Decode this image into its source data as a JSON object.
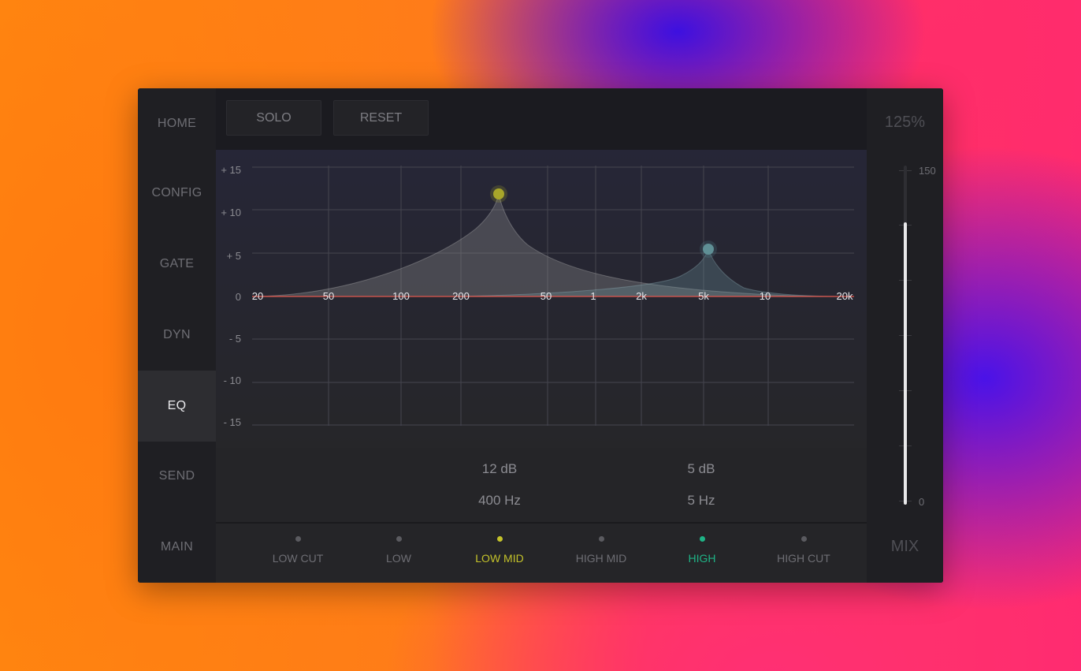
{
  "nav": {
    "items": [
      {
        "label": "HOME"
      },
      {
        "label": "CONFIG"
      },
      {
        "label": "GATE"
      },
      {
        "label": "DYN"
      },
      {
        "label": "EQ"
      },
      {
        "label": "SEND"
      },
      {
        "label": "MAIN"
      }
    ],
    "active": "EQ"
  },
  "toolbar": {
    "solo_label": "SOLO",
    "reset_label": "RESET",
    "power_icon": "power-icon"
  },
  "graph": {
    "y_labels": [
      "+ 15",
      "+ 10",
      "+ 5",
      "0",
      "- 5",
      "- 10",
      "- 15"
    ],
    "x_labels": [
      "20",
      "50",
      "100",
      "200",
      "50",
      "1",
      "2k",
      "5k",
      "10",
      "20k"
    ]
  },
  "readout": {
    "low_mid": {
      "gain": "12 dB",
      "freq": "400 Hz"
    },
    "high": {
      "gain": "5 dB",
      "freq": "5 Hz"
    }
  },
  "bands": [
    {
      "label": "LOW CUT",
      "active": false
    },
    {
      "label": "LOW",
      "active": false
    },
    {
      "label": "LOW MID",
      "active": true,
      "color": "#c4c22a"
    },
    {
      "label": "HIGH MID",
      "active": false
    },
    {
      "label": "HIGH",
      "active": true,
      "color": "#1fb386"
    },
    {
      "label": "HIGH CUT",
      "active": false
    }
  ],
  "mix": {
    "percent": "125%",
    "label": "MIX",
    "scale_max": "150",
    "scale_min": "0",
    "value": 125,
    "max": 150
  },
  "colors": {
    "low_mid": "#c4c22a",
    "high": "#1fb386",
    "zero_line": "#e2574c"
  }
}
